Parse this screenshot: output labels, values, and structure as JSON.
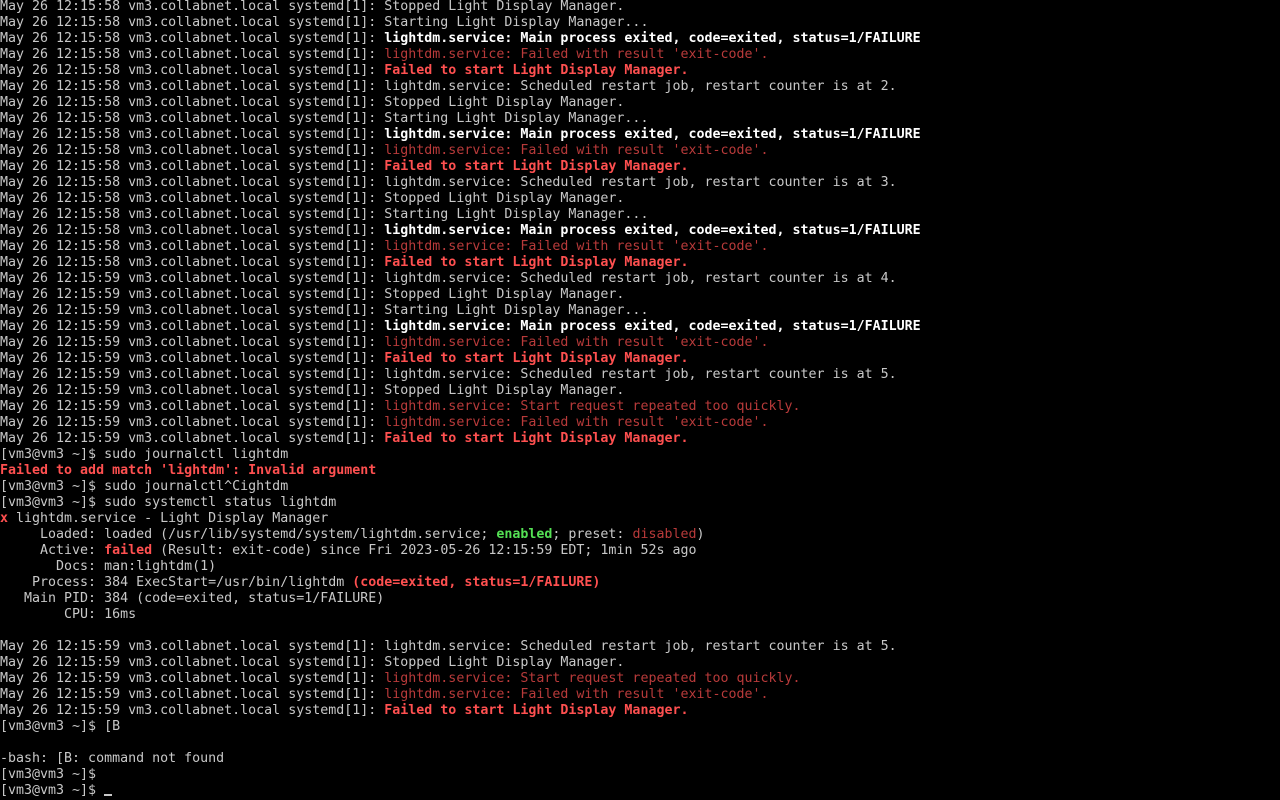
{
  "colors": {
    "background": "#000000",
    "default_text": "#c8c8c8",
    "highlight_text": "#ffffff",
    "error_text": "#ff5050",
    "warning_text": "#b83a3a",
    "enabled_text": "#54e054"
  },
  "terminal": {
    "lines": [
      [
        {
          "t": "May 26 12:15:58 vm3.collabnet.local systemd[1]: ",
          "c": "gray"
        },
        {
          "t": "Stopped Light Display Manager.",
          "c": "gray"
        }
      ],
      [
        {
          "t": "May 26 12:15:58 vm3.collabnet.local systemd[1]: ",
          "c": "gray"
        },
        {
          "t": "Starting Light Display Manager...",
          "c": "gray"
        }
      ],
      [
        {
          "t": "May 26 12:15:58 vm3.collabnet.local systemd[1]: ",
          "c": "gray"
        },
        {
          "t": "lightdm.service: Main process exited, code=exited, status=1/FAILURE",
          "c": "white"
        }
      ],
      [
        {
          "t": "May 26 12:15:58 vm3.collabnet.local systemd[1]: ",
          "c": "gray"
        },
        {
          "t": "lightdm.service: Failed with result 'exit-code'.",
          "c": "dred"
        }
      ],
      [
        {
          "t": "May 26 12:15:58 vm3.collabnet.local systemd[1]: ",
          "c": "gray"
        },
        {
          "t": "Failed to start Light Display Manager.",
          "c": "red"
        }
      ],
      [
        {
          "t": "May 26 12:15:58 vm3.collabnet.local systemd[1]: ",
          "c": "gray"
        },
        {
          "t": "lightdm.service: Scheduled restart job, restart counter is at 2.",
          "c": "gray"
        }
      ],
      [
        {
          "t": "May 26 12:15:58 vm3.collabnet.local systemd[1]: ",
          "c": "gray"
        },
        {
          "t": "Stopped Light Display Manager.",
          "c": "gray"
        }
      ],
      [
        {
          "t": "May 26 12:15:58 vm3.collabnet.local systemd[1]: ",
          "c": "gray"
        },
        {
          "t": "Starting Light Display Manager...",
          "c": "gray"
        }
      ],
      [
        {
          "t": "May 26 12:15:58 vm3.collabnet.local systemd[1]: ",
          "c": "gray"
        },
        {
          "t": "lightdm.service: Main process exited, code=exited, status=1/FAILURE",
          "c": "white"
        }
      ],
      [
        {
          "t": "May 26 12:15:58 vm3.collabnet.local systemd[1]: ",
          "c": "gray"
        },
        {
          "t": "lightdm.service: Failed with result 'exit-code'.",
          "c": "dred"
        }
      ],
      [
        {
          "t": "May 26 12:15:58 vm3.collabnet.local systemd[1]: ",
          "c": "gray"
        },
        {
          "t": "Failed to start Light Display Manager.",
          "c": "red"
        }
      ],
      [
        {
          "t": "May 26 12:15:58 vm3.collabnet.local systemd[1]: ",
          "c": "gray"
        },
        {
          "t": "lightdm.service: Scheduled restart job, restart counter is at 3.",
          "c": "gray"
        }
      ],
      [
        {
          "t": "May 26 12:15:58 vm3.collabnet.local systemd[1]: ",
          "c": "gray"
        },
        {
          "t": "Stopped Light Display Manager.",
          "c": "gray"
        }
      ],
      [
        {
          "t": "May 26 12:15:58 vm3.collabnet.local systemd[1]: ",
          "c": "gray"
        },
        {
          "t": "Starting Light Display Manager...",
          "c": "gray"
        }
      ],
      [
        {
          "t": "May 26 12:15:58 vm3.collabnet.local systemd[1]: ",
          "c": "gray"
        },
        {
          "t": "lightdm.service: Main process exited, code=exited, status=1/FAILURE",
          "c": "white"
        }
      ],
      [
        {
          "t": "May 26 12:15:58 vm3.collabnet.local systemd[1]: ",
          "c": "gray"
        },
        {
          "t": "lightdm.service: Failed with result 'exit-code'.",
          "c": "dred"
        }
      ],
      [
        {
          "t": "May 26 12:15:58 vm3.collabnet.local systemd[1]: ",
          "c": "gray"
        },
        {
          "t": "Failed to start Light Display Manager.",
          "c": "red"
        }
      ],
      [
        {
          "t": "May 26 12:15:59 vm3.collabnet.local systemd[1]: ",
          "c": "gray"
        },
        {
          "t": "lightdm.service: Scheduled restart job, restart counter is at 4.",
          "c": "gray"
        }
      ],
      [
        {
          "t": "May 26 12:15:59 vm3.collabnet.local systemd[1]: ",
          "c": "gray"
        },
        {
          "t": "Stopped Light Display Manager.",
          "c": "gray"
        }
      ],
      [
        {
          "t": "May 26 12:15:59 vm3.collabnet.local systemd[1]: ",
          "c": "gray"
        },
        {
          "t": "Starting Light Display Manager...",
          "c": "gray"
        }
      ],
      [
        {
          "t": "May 26 12:15:59 vm3.collabnet.local systemd[1]: ",
          "c": "gray"
        },
        {
          "t": "lightdm.service: Main process exited, code=exited, status=1/FAILURE",
          "c": "white"
        }
      ],
      [
        {
          "t": "May 26 12:15:59 vm3.collabnet.local systemd[1]: ",
          "c": "gray"
        },
        {
          "t": "lightdm.service: Failed with result 'exit-code'.",
          "c": "dred"
        }
      ],
      [
        {
          "t": "May 26 12:15:59 vm3.collabnet.local systemd[1]: ",
          "c": "gray"
        },
        {
          "t": "Failed to start Light Display Manager.",
          "c": "red"
        }
      ],
      [
        {
          "t": "May 26 12:15:59 vm3.collabnet.local systemd[1]: ",
          "c": "gray"
        },
        {
          "t": "lightdm.service: Scheduled restart job, restart counter is at 5.",
          "c": "gray"
        }
      ],
      [
        {
          "t": "May 26 12:15:59 vm3.collabnet.local systemd[1]: ",
          "c": "gray"
        },
        {
          "t": "Stopped Light Display Manager.",
          "c": "gray"
        }
      ],
      [
        {
          "t": "May 26 12:15:59 vm3.collabnet.local systemd[1]: ",
          "c": "gray"
        },
        {
          "t": "lightdm.service: Start request repeated too quickly.",
          "c": "dred"
        }
      ],
      [
        {
          "t": "May 26 12:15:59 vm3.collabnet.local systemd[1]: ",
          "c": "gray"
        },
        {
          "t": "lightdm.service: Failed with result 'exit-code'.",
          "c": "dred"
        }
      ],
      [
        {
          "t": "May 26 12:15:59 vm3.collabnet.local systemd[1]: ",
          "c": "gray"
        },
        {
          "t": "Failed to start Light Display Manager.",
          "c": "red"
        }
      ],
      [
        {
          "t": "[vm3@vm3 ~]$ sudo journalctl lightdm",
          "c": "gray"
        }
      ],
      [
        {
          "t": "Failed to add match 'lightdm': Invalid argument",
          "c": "red"
        }
      ],
      [
        {
          "t": "[vm3@vm3 ~]$ sudo journalctl^Cightdm",
          "c": "gray"
        }
      ],
      [
        {
          "t": "[vm3@vm3 ~]$ sudo systemctl status lightdm",
          "c": "gray"
        }
      ],
      [
        {
          "t": "x",
          "c": "red"
        },
        {
          "t": " lightdm.service - Light Display Manager",
          "c": "gray"
        }
      ],
      [
        {
          "t": "     Loaded: loaded (/usr/lib/systemd/system/lightdm.service; ",
          "c": "gray"
        },
        {
          "t": "enabled",
          "c": "green"
        },
        {
          "t": "; preset: ",
          "c": "gray"
        },
        {
          "t": "disabled",
          "c": "dred"
        },
        {
          "t": ")",
          "c": "gray"
        }
      ],
      [
        {
          "t": "     Active: ",
          "c": "gray"
        },
        {
          "t": "failed",
          "c": "red"
        },
        {
          "t": " (Result: exit-code) since Fri 2023-05-26 12:15:59 EDT; 1min 52s ago",
          "c": "gray"
        }
      ],
      [
        {
          "t": "       Docs: man:lightdm(1)",
          "c": "gray"
        }
      ],
      [
        {
          "t": "    Process: 384 ExecStart=/usr/bin/lightdm ",
          "c": "gray"
        },
        {
          "t": "(code=exited, status=1/FAILURE)",
          "c": "red"
        }
      ],
      [
        {
          "t": "   Main PID: 384 (code=exited, status=1/FAILURE)",
          "c": "gray"
        }
      ],
      [
        {
          "t": "        CPU: 16ms",
          "c": "gray"
        }
      ],
      [
        {
          "t": "",
          "c": "gray"
        }
      ],
      [
        {
          "t": "May 26 12:15:59 vm3.collabnet.local systemd[1]: ",
          "c": "gray"
        },
        {
          "t": "lightdm.service: Scheduled restart job, restart counter is at 5.",
          "c": "gray"
        }
      ],
      [
        {
          "t": "May 26 12:15:59 vm3.collabnet.local systemd[1]: ",
          "c": "gray"
        },
        {
          "t": "Stopped Light Display Manager.",
          "c": "gray"
        }
      ],
      [
        {
          "t": "May 26 12:15:59 vm3.collabnet.local systemd[1]: ",
          "c": "gray"
        },
        {
          "t": "lightdm.service: Start request repeated too quickly.",
          "c": "dred"
        }
      ],
      [
        {
          "t": "May 26 12:15:59 vm3.collabnet.local systemd[1]: ",
          "c": "gray"
        },
        {
          "t": "lightdm.service: Failed with result 'exit-code'.",
          "c": "dred"
        }
      ],
      [
        {
          "t": "May 26 12:15:59 vm3.collabnet.local systemd[1]: ",
          "c": "gray"
        },
        {
          "t": "Failed to start Light Display Manager.",
          "c": "red"
        }
      ],
      [
        {
          "t": "[vm3@vm3 ~]$ [B",
          "c": "gray"
        }
      ],
      [
        {
          "t": "",
          "c": "gray"
        }
      ],
      [
        {
          "t": "-bash: [B: command not found",
          "c": "gray"
        }
      ],
      [
        {
          "t": "[vm3@vm3 ~]$",
          "c": "gray"
        }
      ],
      [
        {
          "t": "[vm3@vm3 ~]$ ",
          "c": "gray"
        }
      ]
    ]
  }
}
